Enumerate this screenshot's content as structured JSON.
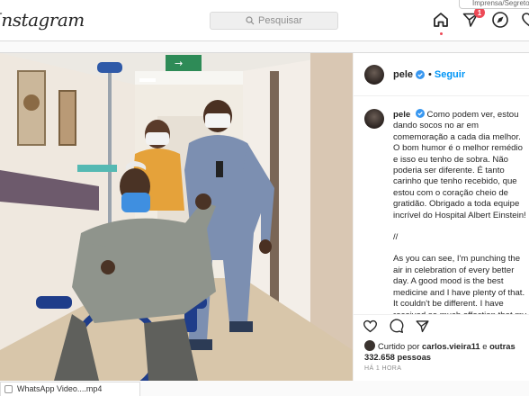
{
  "header": {
    "logo": "Instagram",
    "search_placeholder": "Pesquisar",
    "notification_count": "1",
    "print_tab": "Imprensa/Segreto"
  },
  "post": {
    "username": "pele",
    "separator": "•",
    "follow_label": "Seguir",
    "caption_pt": "Como podem ver, estou dando socos no ar em comemoração a cada dia melhor. O bom humor é o melhor remédio e isso eu tenho de sobra. Não poderia ser diferente. É tanto carinho que tenho recebido, que estou com o coração cheio de gratidão. Obrigado a toda equipe incrível do Hospital Albert Einstein!",
    "caption_sep": "//",
    "caption_en": "As you can see, I'm punching the air in celebration of every better day. A good mood is the best medicine and I have plenty of that. It couldn't be different. I have received so much affection that my heart is full of gratitude. Thanks to all the amazing",
    "liked_prefix": "Curtido por",
    "liked_user": "carlos.vieira11",
    "liked_and": "e",
    "liked_others": "outras 332.658 pessoas",
    "time_ago": "HÁ 1 HORA",
    "photo_sign": "→"
  },
  "download_bar": {
    "file": "WhatsApp Video....mp4"
  },
  "colors": {
    "accent": "#0095f6",
    "badge": "#ed4956",
    "verified": "#3897f0",
    "exit_sign": "#2e8b57"
  }
}
